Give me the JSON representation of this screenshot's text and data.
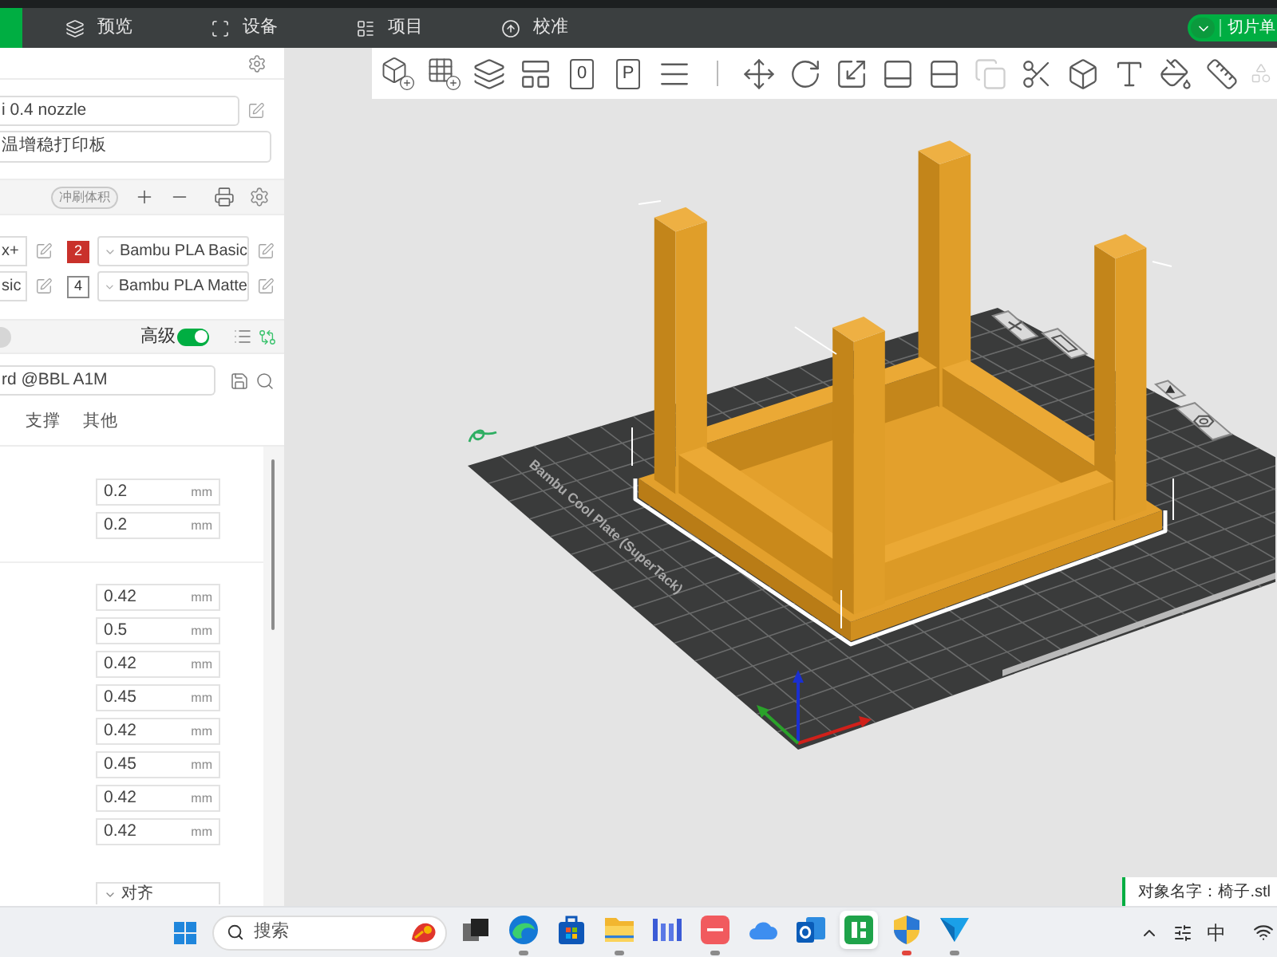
{
  "top_bar": {
    "tabs": [
      {
        "label": "预览",
        "selected": false
      },
      {
        "label": "设备",
        "selected": false
      },
      {
        "label": "项目",
        "selected": false
      },
      {
        "label": "校准",
        "selected": false
      }
    ],
    "slice_button": {
      "label": "切片单"
    }
  },
  "printer": {
    "nozzle": "i 0.4 nozzle",
    "plate": "温增稳打印板"
  },
  "filament": {
    "flush_button": "冲刷体积",
    "items": [
      {
        "preset": "x+"
      },
      {
        "slot": "2",
        "color": "#c9312b",
        "preset": "Bambu PLA Basic"
      },
      {
        "preset": "sic"
      },
      {
        "slot": "4",
        "color": "#ffffff",
        "preset": "Bambu PLA Matte"
      }
    ]
  },
  "process": {
    "advanced": {
      "label": "高级",
      "on": true
    },
    "preset": "rd @BBL A1M",
    "tabs": [
      {
        "label": "支撑",
        "selected": false
      },
      {
        "label": "其他",
        "selected": false
      }
    ],
    "groups": [
      [
        {
          "value": "0.2",
          "unit": "mm"
        },
        {
          "value": "0.2",
          "unit": "mm"
        }
      ],
      [
        {
          "value": "0.42",
          "unit": "mm"
        },
        {
          "value": "0.5",
          "unit": "mm"
        },
        {
          "value": "0.42",
          "unit": "mm"
        },
        {
          "value": "0.45",
          "unit": "mm"
        },
        {
          "value": "0.42",
          "unit": "mm"
        },
        {
          "value": "0.45",
          "unit": "mm"
        },
        {
          "value": "0.42",
          "unit": "mm"
        },
        {
          "value": "0.42",
          "unit": "mm"
        }
      ]
    ],
    "dropdown": {
      "value": "对齐"
    }
  },
  "toolbar": {
    "tools": [
      {
        "disabled": false
      },
      {
        "disabled": false
      },
      {
        "disabled": false
      },
      {
        "disabled": false
      },
      {
        "glyph": "0",
        "disabled": false
      },
      {
        "glyph": "P",
        "disabled": false
      },
      {
        "disabled": false
      },
      {
        "disabled": false
      },
      {
        "disabled": false
      },
      {
        "disabled": false
      },
      {
        "disabled": false
      },
      {
        "disabled": false
      },
      {
        "disabled": true
      },
      {
        "disabled": false
      },
      {
        "disabled": false
      },
      {
        "disabled": false
      },
      {
        "disabled": false
      },
      {
        "disabled": false
      },
      {
        "disabled": true
      }
    ]
  },
  "viewport": {
    "plate_label": "Bambu Cool Plate (SuperTack)",
    "object_name": "对象名字：椅子.stl"
  },
  "taskbar": {
    "search": {
      "placeholder": "搜索"
    },
    "apps": [
      {
        "selected": false,
        "running": false,
        "attention": false
      },
      {
        "selected": false,
        "running": true,
        "attention": false
      },
      {
        "selected": false,
        "running": false,
        "attention": false
      },
      {
        "selected": false,
        "running": true,
        "attention": false
      },
      {
        "selected": false,
        "running": false,
        "attention": false
      },
      {
        "selected": false,
        "running": true,
        "attention": false
      },
      {
        "selected": false,
        "running": false,
        "attention": false
      },
      {
        "selected": false,
        "running": false,
        "attention": false
      },
      {
        "selected": true,
        "running": false,
        "attention": false
      },
      {
        "selected": false,
        "running": true,
        "attention": true
      },
      {
        "selected": false,
        "running": true,
        "attention": false
      }
    ],
    "tray": {
      "input_method": "中"
    }
  }
}
